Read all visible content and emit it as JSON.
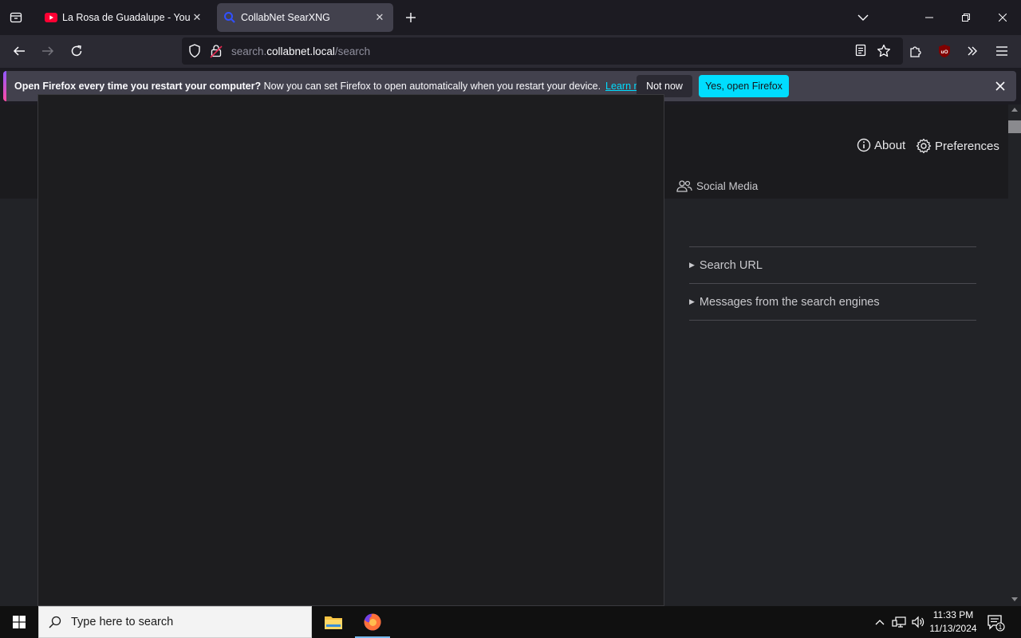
{
  "browser": {
    "tabs": [
      {
        "title": "La Rosa de Guadalupe - YouTube",
        "favicon": "youtube-icon",
        "active": false
      },
      {
        "title": "CollabNet SearXNG",
        "favicon": "searxng-icon",
        "active": true
      }
    ],
    "url": {
      "prefix": "search.",
      "host": "collabnet.local",
      "path": "/search"
    },
    "ublock_badge": "uO"
  },
  "notification": {
    "bold": "Open Firefox every time you restart your computer?",
    "text": "Now you can set Firefox to open automatically when you restart your device.",
    "link": "Learn more",
    "not_now": "Not now",
    "yes": "Yes, open Firefox"
  },
  "page": {
    "about": "About",
    "preferences": "Preferences",
    "category_social": "Social Media",
    "sidebar": [
      "Search URL",
      "Messages from the search engines"
    ]
  },
  "taskbar": {
    "search_placeholder": "Type here to search",
    "time": "11:33 PM",
    "date": "11/13/2024",
    "notifications_count": "1"
  },
  "colors": {
    "accent": "#00ddff",
    "tab_active": "#42414d",
    "page_bg": "#222327"
  }
}
